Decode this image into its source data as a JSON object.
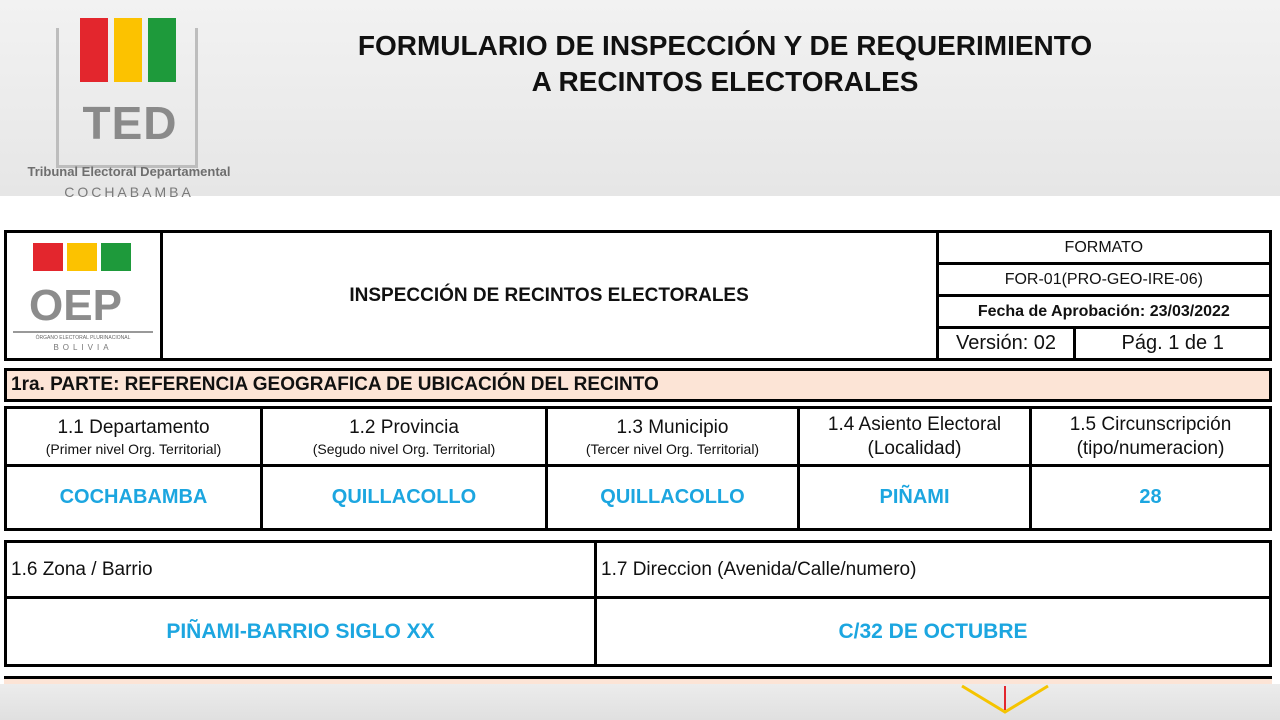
{
  "header": {
    "title_line1": "FORMULARIO DE INSPECCIÓN Y DE REQUERIMIENTO",
    "title_line2": "A RECINTOS ELECTORALES",
    "logo": {
      "word": "TED",
      "caption": "Tribunal Electoral Departamental",
      "city": "COCHABAMBA",
      "colors": [
        "#e3262d",
        "#fcc200",
        "#1e9a3b"
      ]
    }
  },
  "form_header": {
    "oep_logo": {
      "word": "OEP",
      "subtitle": "ÓRGANO ELECTORAL PLURINACIONAL",
      "country": "BOLIVIA"
    },
    "doc_title": "INSPECCIÓN DE RECINTOS ELECTORALES",
    "formato_label": "FORMATO",
    "code": "FOR-01(PRO-GEO-IRE-06)",
    "approval": "Fecha de Aprobación: 23/03/2022",
    "version": "Versión: 02",
    "page": "Pág. 1 de 1"
  },
  "section1": {
    "title": "1ra. PARTE: REFERENCIA GEOGRAFICA DE UBICACIÓN DEL RECINTO",
    "columns": [
      {
        "label": "1.1 Departamento",
        "sub": "(Primer nivel Org. Territorial)",
        "value": "COCHABAMBA"
      },
      {
        "label": "1.2 Provincia",
        "sub": "(Segudo nivel Org. Territorial)",
        "value": "QUILLACOLLO"
      },
      {
        "label": "1.3 Municipio",
        "sub": "(Tercer nivel Org. Territorial)",
        "value": "QUILLACOLLO"
      },
      {
        "label": "1.4 Asiento Electoral",
        "sub": "(Localidad)",
        "value": "PIÑAMI"
      },
      {
        "label": "1.5 Circunscripción",
        "sub": "(tipo/numeracion)",
        "value": "28"
      }
    ],
    "address": [
      {
        "label": "1.6 Zona / Barrio",
        "value": "PIÑAMI-BARRIO SIGLO XX"
      },
      {
        "label": "1.7 Direccion (Avenida/Calle/numero)",
        "value": "C/32 DE OCTUBRE"
      }
    ]
  },
  "colors": {
    "value_blue": "#1ca6e0",
    "section_fill": "#fce4d6",
    "border": "#000000"
  }
}
